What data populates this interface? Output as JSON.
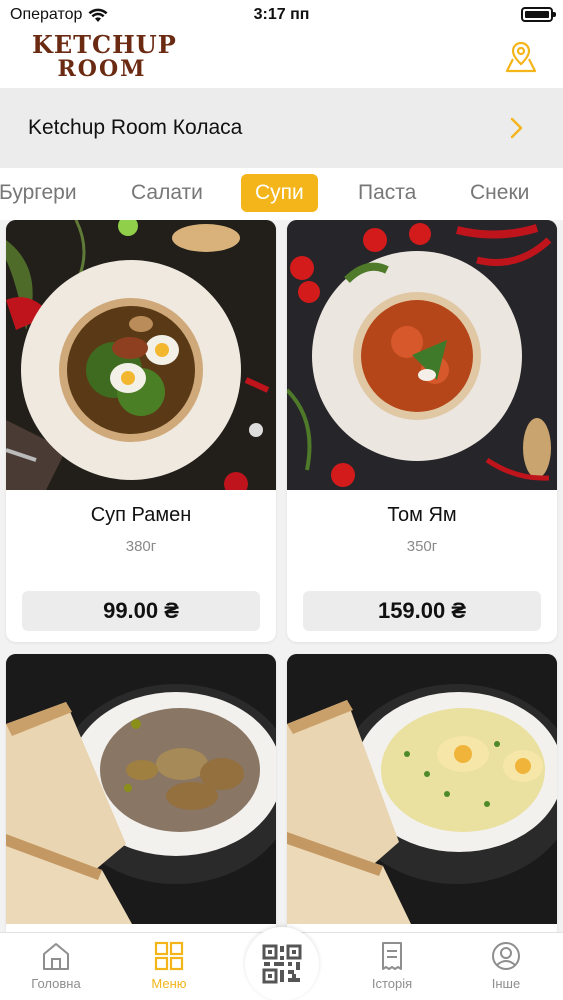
{
  "status_bar": {
    "carrier": "Оператор",
    "time": "3:17 пп"
  },
  "header": {
    "logo_line1": "KETCHUP",
    "logo_line2": "ROOM"
  },
  "restaurant": {
    "name": "Ketchup Room Коласа"
  },
  "categories": {
    "items": [
      "Бургери",
      "Салати",
      "Супи",
      "Паста",
      "Снеки"
    ],
    "selected": "Супи"
  },
  "products": [
    {
      "name": "Суп Рамен",
      "weight": "380г",
      "price": "99.00 ₴"
    },
    {
      "name": "Том Ям",
      "weight": "350г",
      "price": "159.00 ₴"
    },
    {
      "name": "",
      "weight": "",
      "price": ""
    },
    {
      "name": "",
      "weight": "",
      "price": ""
    }
  ],
  "tabbar": {
    "home": "Головна",
    "menu": "Меню",
    "history": "Історія",
    "other": "Інше"
  },
  "colors": {
    "accent": "#f4b51a",
    "logo": "#6b2a12"
  }
}
